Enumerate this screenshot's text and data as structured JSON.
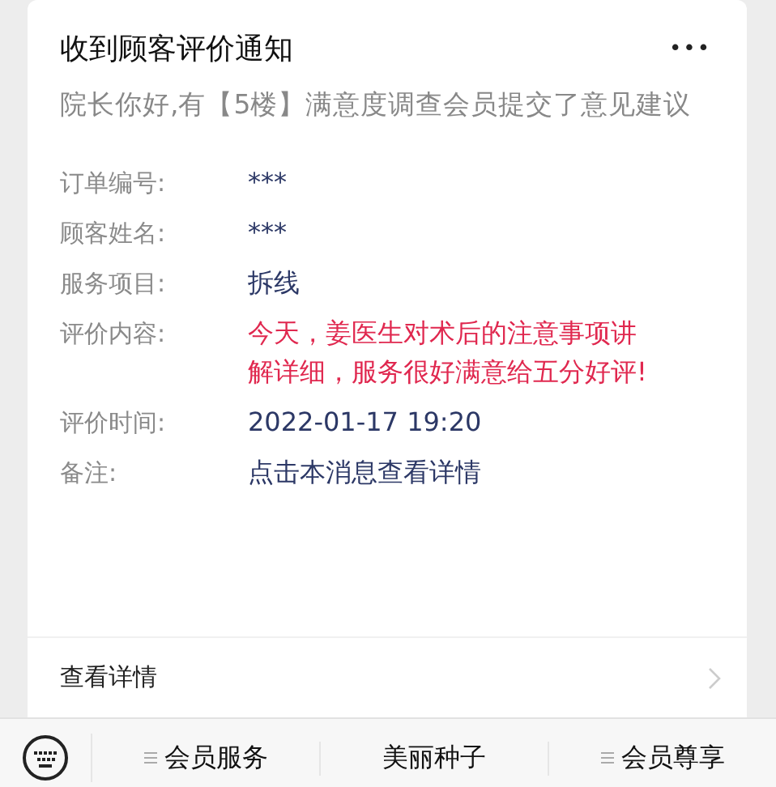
{
  "card": {
    "title": "收到顾客评价通知",
    "more": "•••",
    "summary": "院长你好,有【5楼】满意度调查会员提交了意见建议",
    "fields": [
      {
        "label": "订单编号:",
        "value": "***",
        "kind": "plain"
      },
      {
        "label": "顾客姓名:",
        "value": "***",
        "kind": "plain"
      },
      {
        "label": "服务项目:",
        "value": "拆线",
        "kind": "plain"
      },
      {
        "label": "评价内容:",
        "value": "今天，姜医生对术后的注意事项讲解详细，服务很好满意给五分好评!",
        "kind": "highlight"
      },
      {
        "label": "评价时间:",
        "value": "2022-01-17 19:20",
        "kind": "plain"
      },
      {
        "label": "备注:",
        "value": "点击本消息查看详情",
        "kind": "plain"
      }
    ],
    "link": "查看详情"
  },
  "menu": [
    {
      "label": "会员服务",
      "submenu": true
    },
    {
      "label": "美丽种子",
      "submenu": false
    },
    {
      "label": "会员尊享",
      "submenu": true
    }
  ]
}
